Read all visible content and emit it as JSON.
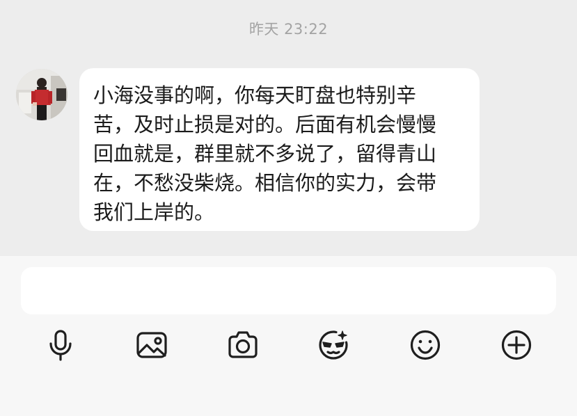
{
  "chat": {
    "timestamp": "昨天 23:22",
    "message": {
      "lines": [
        "小海没事的啊，你每天盯盘也特别辛",
        "苦，及时止损是对的。后面有机会慢慢",
        "回血就是，群里就不多说了，留得青山",
        "在，不愁没柴烧。相信你的实力，会带",
        "我们上岸的。"
      ]
    }
  },
  "input": {
    "value": ""
  },
  "toolbar": {
    "icons": [
      "microphone-icon",
      "image-icon",
      "camera-icon",
      "sticker-icon",
      "emoji-icon",
      "plus-icon"
    ]
  },
  "colors": {
    "chat_background": "#ededed",
    "bubble": "#ffffff",
    "panel": "#f7f7f7",
    "text": "#1b1b1b",
    "timestamp": "#a3a3a3",
    "icon": "#1f1f1f"
  }
}
